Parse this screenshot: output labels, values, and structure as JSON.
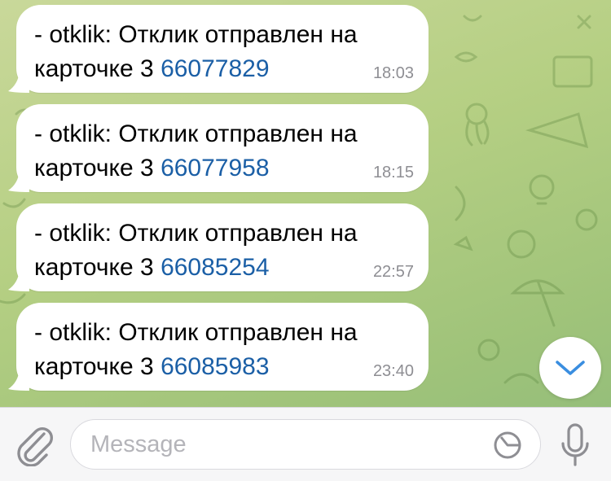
{
  "messages": [
    {
      "text": "- otklik: Отклик отправлен на",
      "prefix": "карточке 3 ",
      "link": "66077829",
      "time": "18:03"
    },
    {
      "text": "- otklik: Отклик отправлен на",
      "prefix": "карточке 3 ",
      "link": "66077958",
      "time": "18:15"
    },
    {
      "text": "- otklik: Отклик отправлен на",
      "prefix": "карточке 3 ",
      "link": "66085254",
      "time": "22:57"
    },
    {
      "text": "- otklik: Отклик отправлен на",
      "prefix": "карточке 3 ",
      "link": "66085983",
      "time": "23:40"
    }
  ],
  "input": {
    "placeholder": "Message"
  },
  "icons": {
    "attach": "paperclip-icon",
    "sticker": "sticker-icon",
    "mic": "microphone-icon",
    "scroll": "chevron-down-icon"
  },
  "colors": {
    "link": "#1b5fa6",
    "accent": "#3a8ee0",
    "time": "#8e8e93"
  }
}
